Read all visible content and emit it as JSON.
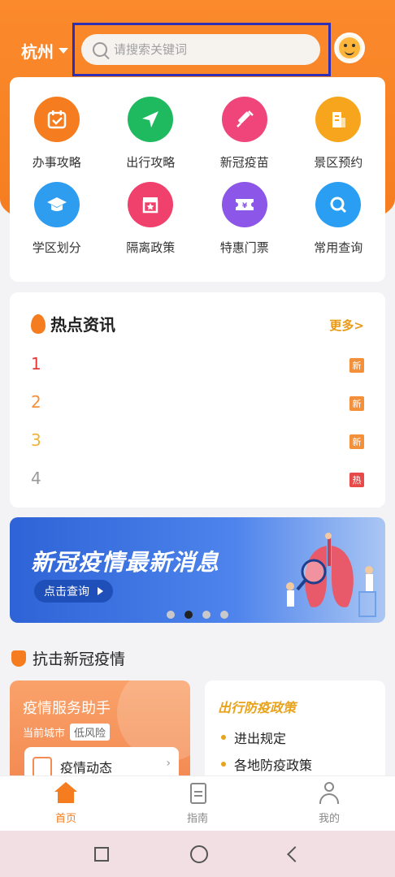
{
  "header": {
    "city": "杭州",
    "search_placeholder": "请搜索关键词"
  },
  "services": [
    {
      "label": "办事攻略",
      "icon": "calendar-check-icon",
      "color": "#f57d1f"
    },
    {
      "label": "出行攻略",
      "icon": "paper-plane-icon",
      "color": "#1fba5f"
    },
    {
      "label": "新冠疫苗",
      "icon": "syringe-icon",
      "color": "#f0457a"
    },
    {
      "label": "景区预约",
      "icon": "building-icon",
      "color": "#f7a51d"
    },
    {
      "label": "学区划分",
      "icon": "graduation-cap-icon",
      "color": "#2e9df0"
    },
    {
      "label": "隔离政策",
      "icon": "quarantine-box-icon",
      "color": "#f0406c"
    },
    {
      "label": "特惠门票",
      "icon": "ticket-icon",
      "color": "#8c57e8"
    },
    {
      "label": "常用查询",
      "icon": "search-icon",
      "color": "#2a9ef2"
    }
  ],
  "news": {
    "title": "热点资讯",
    "more": "更多>",
    "items": [
      {
        "num": "1",
        "num_color": "#e23b3b",
        "badge": "新",
        "badge_color": "#f5903a"
      },
      {
        "num": "2",
        "num_color": "#f5903a",
        "badge": "新",
        "badge_color": "#f5903a"
      },
      {
        "num": "3",
        "num_color": "#f0b23a",
        "badge": "新",
        "badge_color": "#f5903a"
      },
      {
        "num": "4",
        "num_color": "#999999",
        "badge": "热",
        "badge_color": "#e84a4a"
      }
    ]
  },
  "banner": {
    "title": "新冠疫情最新消息",
    "button": "点击查询",
    "dots_active_index": 1,
    "dots_count": 4
  },
  "section": {
    "title": "抗击新冠疫情"
  },
  "assistant": {
    "title": "疫情服务助手",
    "city_label": "当前城市",
    "risk": "低风险",
    "card_text": "疫情动态",
    "card_chevron": "›"
  },
  "policy": {
    "title": "出行防疫政策",
    "items": [
      "进出规定",
      "各地防疫政策"
    ]
  },
  "tabs": [
    {
      "label": "首页",
      "icon": "home-icon",
      "active": true
    },
    {
      "label": "指南",
      "icon": "document-icon",
      "active": false
    },
    {
      "label": "我的",
      "icon": "user-icon",
      "active": false
    }
  ]
}
